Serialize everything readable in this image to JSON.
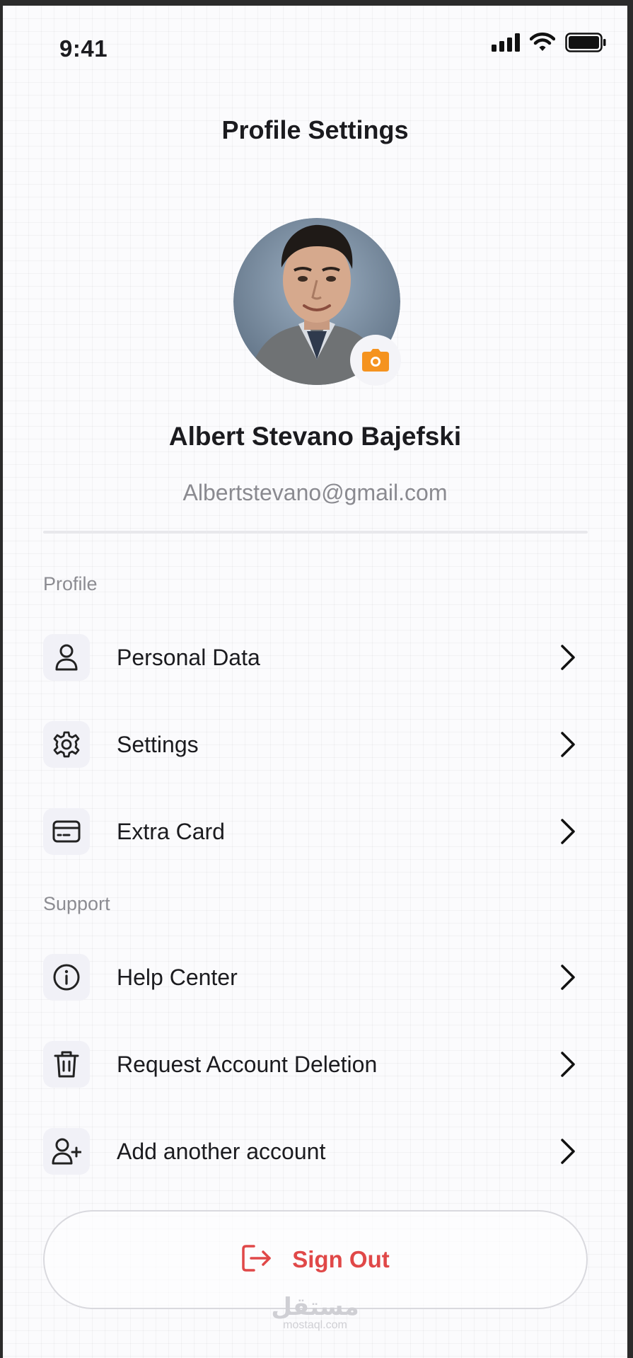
{
  "status_bar": {
    "time": "9:41",
    "icons": [
      "signal-icon",
      "wifi-icon",
      "battery-icon"
    ]
  },
  "header": {
    "title": "Profile Settings"
  },
  "profile": {
    "name": "Albert Stevano Bajefski",
    "email": "Albertstevano@gmail.com",
    "avatar_icon": "avatar-photo",
    "camera_icon": "camera-icon"
  },
  "sections": {
    "profile": {
      "label": "Profile",
      "items": [
        {
          "label": "Personal Data",
          "icon": "user-icon"
        },
        {
          "label": "Settings",
          "icon": "gear-icon"
        },
        {
          "label": "Extra Card",
          "icon": "card-icon"
        }
      ]
    },
    "support": {
      "label": "Support",
      "items": [
        {
          "label": "Help Center",
          "icon": "info-icon"
        },
        {
          "label": "Request Account Deletion",
          "icon": "trash-icon"
        },
        {
          "label": "Add another account",
          "icon": "user-plus-icon"
        }
      ]
    }
  },
  "sign_out": {
    "label": "Sign Out",
    "icon": "logout-icon"
  },
  "watermark": {
    "arabic": "مستقل",
    "latin": "mostaql.com"
  },
  "colors": {
    "accent_orange": "#f5931f",
    "danger_red": "#e04848",
    "text_primary": "#1b1b1f",
    "text_secondary": "#8a8a90",
    "icon_bg": "#f1f1f7"
  }
}
